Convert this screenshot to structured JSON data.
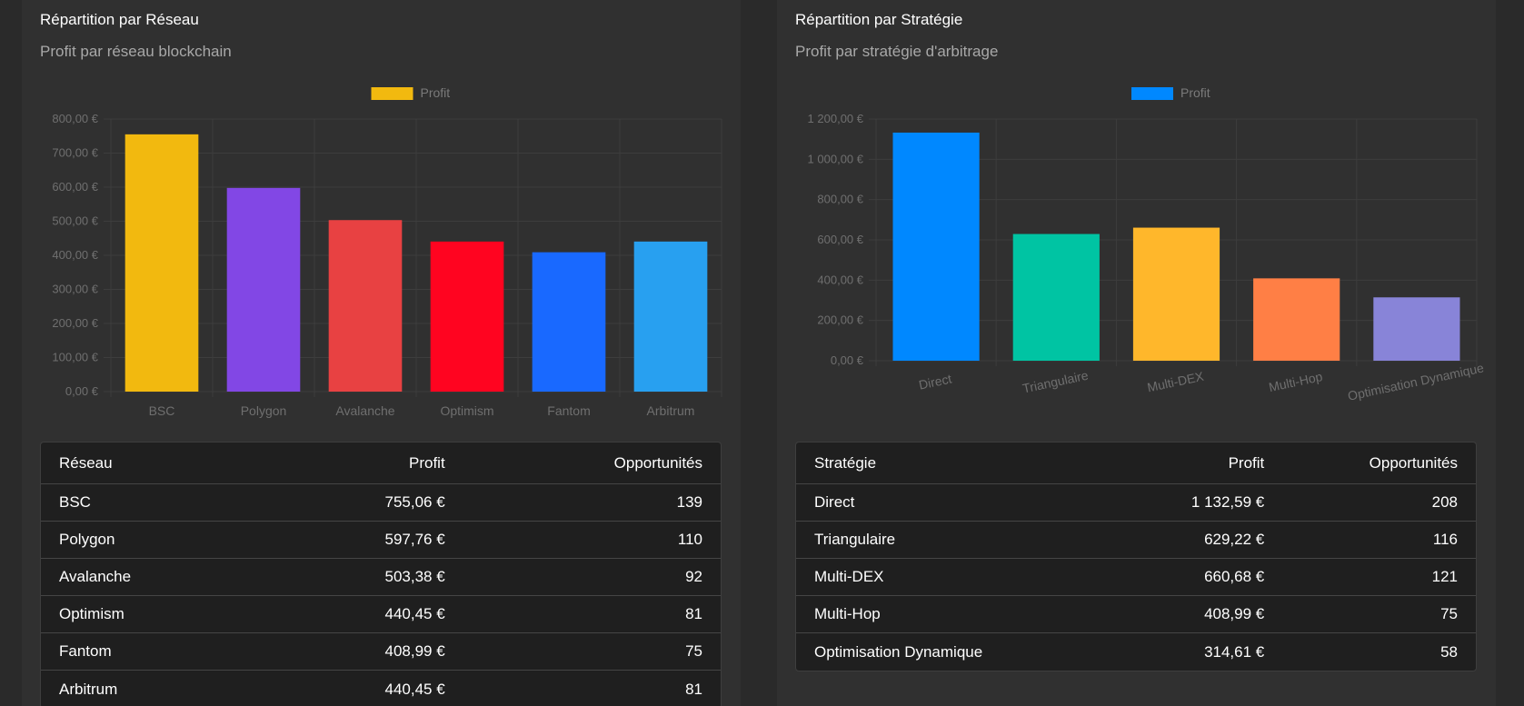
{
  "network_card": {
    "title": "Répartition par Réseau",
    "subtitle": "Profit par réseau blockchain",
    "table": {
      "headers": [
        "Réseau",
        "Profit",
        "Opportunités"
      ],
      "rows": [
        [
          "BSC",
          "755,06 €",
          "139"
        ],
        [
          "Polygon",
          "597,76 €",
          "110"
        ],
        [
          "Avalanche",
          "503,38 €",
          "92"
        ],
        [
          "Optimism",
          "440,45 €",
          "81"
        ],
        [
          "Fantom",
          "408,99 €",
          "75"
        ],
        [
          "Arbitrum",
          "440,45 €",
          "81"
        ]
      ]
    }
  },
  "strategy_card": {
    "title": "Répartition par Stratégie",
    "subtitle": "Profit par stratégie d'arbitrage",
    "table": {
      "headers": [
        "Stratégie",
        "Profit",
        "Opportunités"
      ],
      "rows": [
        [
          "Direct",
          "1 132,59 €",
          "208"
        ],
        [
          "Triangulaire",
          "629,22 €",
          "116"
        ],
        [
          "Multi-DEX",
          "660,68 €",
          "121"
        ],
        [
          "Multi-Hop",
          "408,99 €",
          "75"
        ],
        [
          "Optimisation Dynamique",
          "314,61 €",
          "58"
        ]
      ]
    }
  },
  "chart_data": [
    {
      "type": "bar",
      "legend": "Profit",
      "legend_position": "top",
      "legend_color": "#f2b90f",
      "categories": [
        "BSC",
        "Polygon",
        "Avalanche",
        "Optimism",
        "Fantom",
        "Arbitrum"
      ],
      "values": [
        755.06,
        597.76,
        503.38,
        440.45,
        408.99,
        440.45
      ],
      "colors": [
        "#f2b90f",
        "#8247e5",
        "#e84142",
        "#ff0420",
        "#1969ff",
        "#28a0f0"
      ],
      "ylim": [
        0,
        800
      ],
      "yticks": [
        "0,00 €",
        "100,00 €",
        "200,00 €",
        "300,00 €",
        "400,00 €",
        "500,00 €",
        "600,00 €",
        "700,00 €",
        "800,00 €"
      ],
      "grid": true
    },
    {
      "type": "bar",
      "legend": "Profit",
      "legend_position": "top",
      "legend_color": "#0088ff",
      "categories": [
        "Direct",
        "Triangulaire",
        "Multi-DEX",
        "Multi-Hop",
        "Optimisation Dynamique"
      ],
      "values": [
        1132.59,
        629.22,
        660.68,
        408.99,
        314.61
      ],
      "colors": [
        "#0088ff",
        "#00c4a3",
        "#ffb72b",
        "#ff7f45",
        "#8884d8"
      ],
      "ylim": [
        0,
        1200
      ],
      "yticks": [
        "0,00 €",
        "200,00 €",
        "400,00 €",
        "600,00 €",
        "800,00 €",
        "1 000,00 €",
        "1 200,00 €"
      ],
      "grid": true
    }
  ]
}
